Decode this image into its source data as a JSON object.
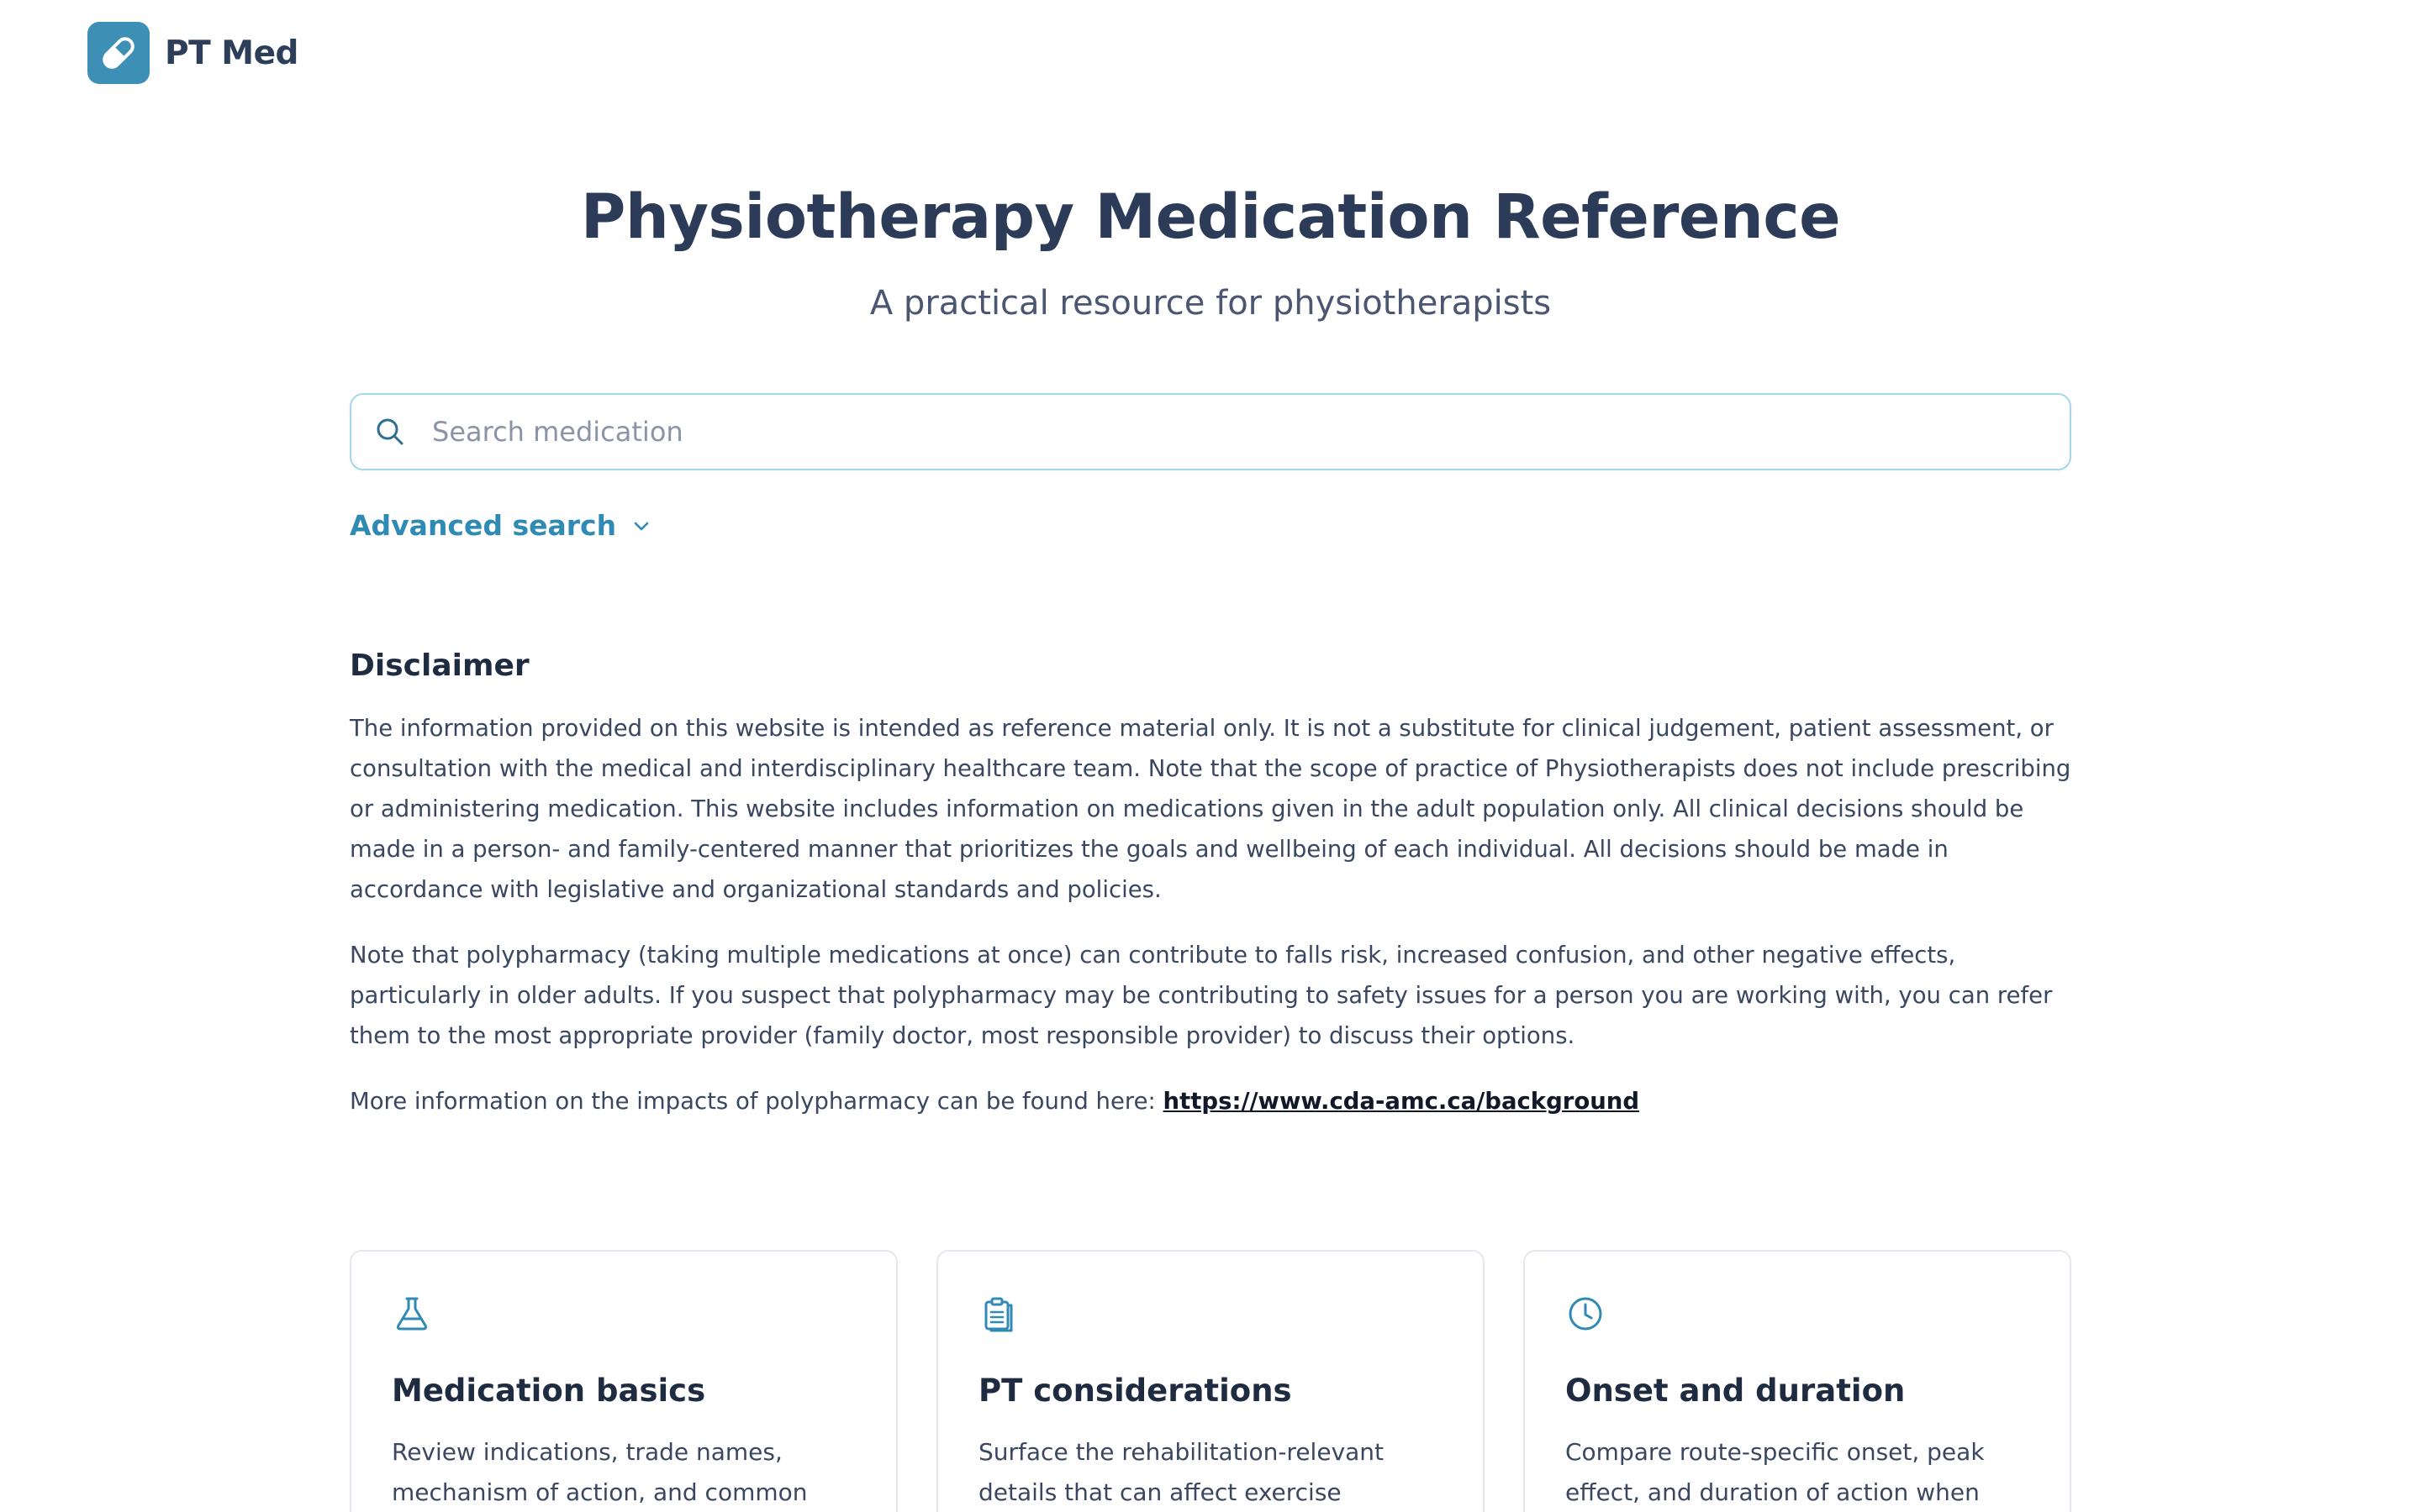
{
  "brand": {
    "name": "PT Med",
    "icon": "pill-icon",
    "color": "#3d8fb5"
  },
  "hero": {
    "title": "Physiotherapy Medication Reference",
    "subtitle": "A practical resource for physiotherapists"
  },
  "search": {
    "placeholder": "Search medication",
    "value": "",
    "icon": "search-icon"
  },
  "advanced_search": {
    "label": "Advanced search",
    "icon": "chevron-down-icon"
  },
  "disclaimer": {
    "heading": "Disclaimer",
    "paragraph1": "The information provided on this website is intended as reference material only. It is not a substitute for clinical judgement, patient assessment, or consultation with the medical and interdisciplinary healthcare team. Note that the scope of practice of Physiotherapists does not include prescribing or administering medication. This website includes information on medications given in the adult population only. All clinical decisions should be made in a person- and family-centered manner that prioritizes the goals and wellbeing of each individual. All decisions should be made in accordance with legislative and organizational standards and policies.",
    "paragraph2": "Note that polypharmacy (taking multiple medications at once) can contribute to falls risk, increased confusion, and other negative effects, particularly in older adults. If you suspect that polypharmacy may be contributing to safety issues for a person you are working with, you can refer them to the most appropriate provider (family doctor, most responsible provider) to discuss their options.",
    "paragraph3_prefix": "More information on the impacts of polypharmacy can be found here: ",
    "link_text": "https://www.cda-amc.ca/background"
  },
  "cards": [
    {
      "icon": "flask-icon",
      "title": "Medication basics",
      "description": "Review indications, trade names, mechanism of action, and common"
    },
    {
      "icon": "clipboard-icon",
      "title": "PT considerations",
      "description": "Surface the rehabilitation-relevant details that can affect exercise"
    },
    {
      "icon": "clock-icon",
      "title": "Onset and duration",
      "description": "Compare route-specific onset, peak effect, and duration of action when"
    }
  ],
  "colors": {
    "accent": "#2f8ab4",
    "text_primary": "#2c3c58",
    "search_border": "#a8d6ea"
  }
}
